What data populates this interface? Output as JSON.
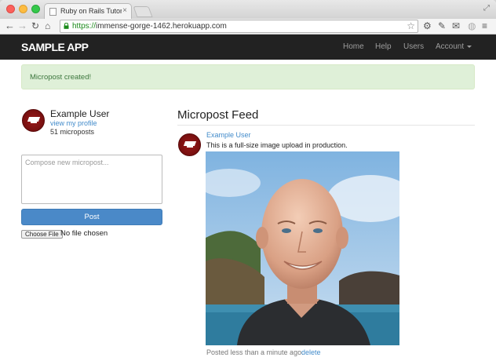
{
  "browser": {
    "tab_title": "Ruby on Rails Tutorial Sam",
    "tab_close": "×",
    "url_scheme": "https://",
    "url_host": "immense-gorge-1462.herokuapp.com"
  },
  "navbar": {
    "logo": "SAMPLE APP",
    "links": {
      "home": "Home",
      "help": "Help",
      "users": "Users",
      "account": "Account"
    }
  },
  "flash": {
    "message": "Micropost created!"
  },
  "sidebar": {
    "user_name": "Example User",
    "profile_link": "view my profile",
    "micropost_count": "51 microposts"
  },
  "compose": {
    "placeholder": "Compose new micropost...",
    "post_label": "Post",
    "choose_file_label": "Choose File",
    "no_file_text": "No file chosen"
  },
  "feed": {
    "title": "Micropost Feed",
    "post": {
      "user": "Example User",
      "content": "This is a full-size image upload in production.",
      "timestamp": "Posted less than a minute ago.",
      "delete_label": "delete"
    }
  },
  "colors": {
    "navbar": "#222222",
    "flash_bg": "#dff0d8",
    "flash_text": "#3c763d",
    "link": "#428bca",
    "button": "#4a89c8",
    "avatar": "#7a1010"
  }
}
